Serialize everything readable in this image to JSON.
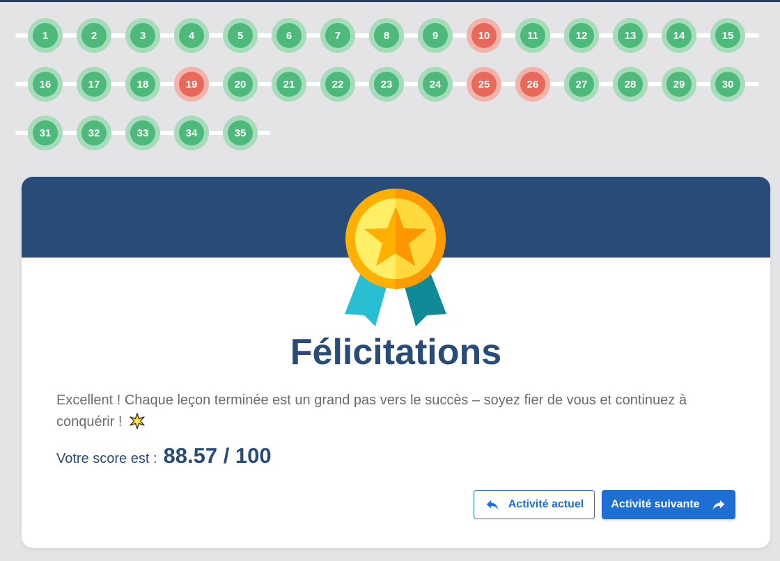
{
  "progress": {
    "rows": [
      [
        {
          "label": "1",
          "status": "done"
        },
        {
          "label": "2",
          "status": "done"
        },
        {
          "label": "3",
          "status": "done"
        },
        {
          "label": "4",
          "status": "done"
        },
        {
          "label": "5",
          "status": "done"
        },
        {
          "label": "6",
          "status": "done"
        },
        {
          "label": "7",
          "status": "done"
        },
        {
          "label": "8",
          "status": "done"
        },
        {
          "label": "9",
          "status": "done"
        },
        {
          "label": "10",
          "status": "fail"
        },
        {
          "label": "11",
          "status": "done"
        },
        {
          "label": "12",
          "status": "done"
        },
        {
          "label": "13",
          "status": "done"
        },
        {
          "label": "14",
          "status": "done"
        },
        {
          "label": "15",
          "status": "done"
        }
      ],
      [
        {
          "label": "16",
          "status": "done"
        },
        {
          "label": "17",
          "status": "done"
        },
        {
          "label": "18",
          "status": "done"
        },
        {
          "label": "19",
          "status": "fail"
        },
        {
          "label": "20",
          "status": "done"
        },
        {
          "label": "21",
          "status": "done"
        },
        {
          "label": "22",
          "status": "done"
        },
        {
          "label": "23",
          "status": "done"
        },
        {
          "label": "24",
          "status": "done"
        },
        {
          "label": "25",
          "status": "fail"
        },
        {
          "label": "26",
          "status": "fail"
        },
        {
          "label": "27",
          "status": "done"
        },
        {
          "label": "28",
          "status": "done"
        },
        {
          "label": "29",
          "status": "done"
        },
        {
          "label": "30",
          "status": "done"
        }
      ],
      [
        {
          "label": "31",
          "status": "done"
        },
        {
          "label": "32",
          "status": "done"
        },
        {
          "label": "33",
          "status": "done"
        },
        {
          "label": "34",
          "status": "done"
        },
        {
          "label": "35",
          "status": "done"
        }
      ]
    ]
  },
  "colors": {
    "done": "#4db97a",
    "fail": "#e8695a",
    "brand": "#284c77",
    "button": "#1d6fd3"
  },
  "card": {
    "title": "Félicitations",
    "message": "Excellent ! Chaque leçon terminée est un grand pas vers le succès – soyez fier de vous et continuez à conquérir !",
    "message_icon": "sparkle-icon",
    "score_label": "Votre score est :",
    "score_value": "88.57 / 100",
    "medal_icon": "medal-icon"
  },
  "buttons": {
    "current_label": "Activité actuel",
    "current_icon": "reply-arrow-icon",
    "next_label": "Activité suivante",
    "next_icon": "forward-arrow-icon"
  }
}
